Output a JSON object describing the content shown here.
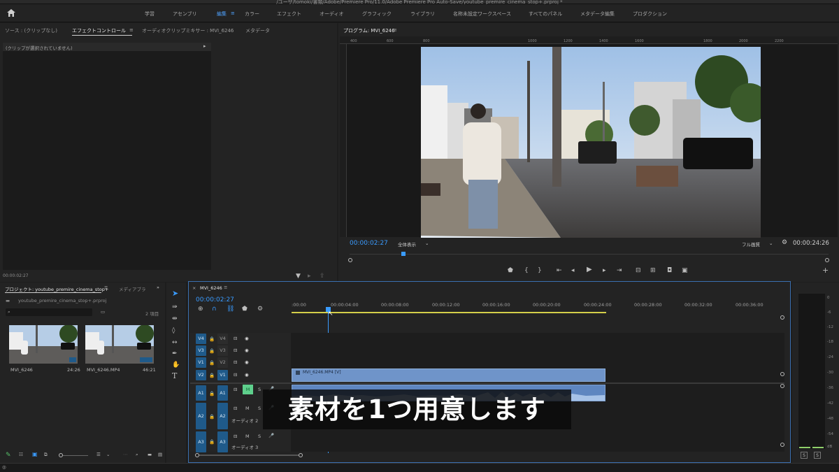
{
  "window": {
    "title": "/ユーザ/tomoki/書類/Adobe/Premiere Pro/11.0/Adobe Premiere Pro Auto-Save/youtube_premire_cinema_stop+.prproj *"
  },
  "workspaces": [
    {
      "label": "学習",
      "active": false
    },
    {
      "label": "アセンブリ",
      "active": false
    },
    {
      "label": "編集",
      "active": true
    },
    {
      "label": "カラー",
      "active": false
    },
    {
      "label": "エフェクト",
      "active": false
    },
    {
      "label": "オーディオ",
      "active": false
    },
    {
      "label": "グラフィック",
      "active": false
    },
    {
      "label": "ライブラリ",
      "active": false
    },
    {
      "label": "名称未設定ワークスペース",
      "active": false
    },
    {
      "label": "すべてのパネル",
      "active": false
    },
    {
      "label": "メタデータ編集",
      "active": false
    },
    {
      "label": "プロダクション",
      "active": false
    }
  ],
  "source_panel": {
    "tabs": [
      "ソース : (クリップなし)",
      "エフェクトコントロール",
      "オーディオクリップミキサー : MVI_6246",
      "メタデータ"
    ],
    "active_tab": 1,
    "no_clip_text": "(クリップが選択されていません)",
    "timecode": "00:00:02:27"
  },
  "program_monitor": {
    "title": "プログラム: MVI_6246",
    "timecode": "00:00:02:27",
    "fit": "全体表示",
    "quality": "フル画質",
    "duration": "00:00:24:26",
    "ruler": [
      "400",
      "600",
      "800",
      "1000",
      "1200",
      "1400",
      "1600",
      "1800",
      "2000",
      "2200"
    ],
    "playhead_fraction": 0.11
  },
  "project_panel": {
    "tabs": [
      "プロジェクト: youtube_premire_cinema_stop+",
      "メディアブラ"
    ],
    "file": "youtube_premire_cinema_stop+.prproj",
    "item_count": "2 項目",
    "items": [
      {
        "name": "MVI_6246",
        "duration": "24:26"
      },
      {
        "name": "MVI_6246.MP4",
        "duration": "46:21"
      }
    ]
  },
  "timeline": {
    "sequence": "MVI_6246",
    "timecode": "00:00:02:27",
    "ruler": [
      ":00:00",
      "00:00:04:00",
      "00:00:08:00",
      "00:00:12:00",
      "00:00:16:00",
      "00:00:20:00",
      "00:00:24:00",
      "00:00:28:00",
      "00:00:32:00",
      "00:00:36:00"
    ],
    "video_tracks": [
      {
        "src": "V4",
        "label": "V4"
      },
      {
        "src": "V3",
        "label": "V3"
      },
      {
        "src": "V1",
        "label": "V2"
      },
      {
        "src": "V2",
        "label": "V1"
      }
    ],
    "audio_tracks": [
      {
        "src": "A1",
        "label": "A1",
        "name": ""
      },
      {
        "src": "A2",
        "label": "A2",
        "name": "オーディオ 2"
      },
      {
        "src": "A3",
        "label": "A3",
        "name": "オーディオ 3"
      }
    ],
    "clip_label": "MVI_6246.MP4 [V]",
    "mute": "M",
    "solo": "S"
  },
  "meter": {
    "labels": [
      "0",
      "-6",
      "-12",
      "-18",
      "-24",
      "-30",
      "-36",
      "-42",
      "-48",
      "-54",
      "dB"
    ],
    "solo": "S"
  },
  "subtitle": "素材を1つ用意します",
  "colors": {
    "accent": "#3a9bff",
    "clip_video": "#6f94c9",
    "clip_audio": "#5e86c0",
    "work_area": "#d4cf4a"
  }
}
